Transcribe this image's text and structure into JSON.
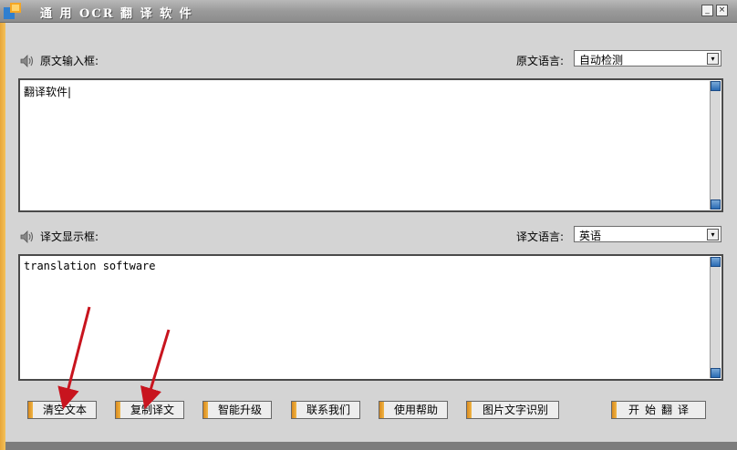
{
  "window": {
    "title": "通 用 OCR 翻 译 软 件",
    "min_label": "_",
    "close_label": "×"
  },
  "source": {
    "label": "原文输入框:",
    "lang_label": "原文语言:",
    "lang_value": "自动检测",
    "text": "翻译软件|"
  },
  "target": {
    "label": "译文显示框:",
    "lang_label": "译文语言:",
    "lang_value": "英语",
    "text": "translation software"
  },
  "buttons": {
    "clear": "清空文本",
    "copy": "复制译文",
    "upgrade": "智能升级",
    "contact": "联系我们",
    "help": "使用帮助",
    "ocr": "图片文字识别",
    "start": "开始翻译"
  },
  "colors": {
    "accent_orange": "#f0b545",
    "arrow_red": "#c8141e",
    "scroll_blue": "#2a6bb4"
  }
}
